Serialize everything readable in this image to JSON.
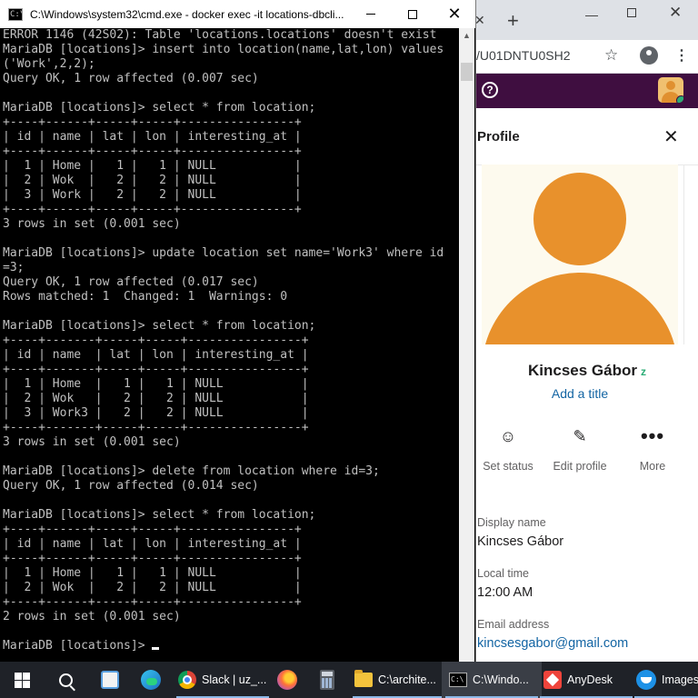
{
  "cmd_window": {
    "title": "C:\\Windows\\system32\\cmd.exe - docker  exec -it locations-dbcli...",
    "app_icon_glyph": "C:\\",
    "controls": {
      "minimize": "",
      "maximize": "",
      "close": "✕"
    },
    "console_lines": [
      "ERROR 1146 (42S02): Table 'locations.locations' doesn't exist",
      "MariaDB [locations]> insert into location(name,lat,lon) values",
      "('Work',2,2);",
      "Query OK, 1 row affected (0.007 sec)",
      "",
      "MariaDB [locations]> select * from location;",
      "+----+------+-----+-----+----------------+",
      "| id | name | lat | lon | interesting_at |",
      "+----+------+-----+-----+----------------+",
      "|  1 | Home |   1 |   1 | NULL           |",
      "|  2 | Wok  |   2 |   2 | NULL           |",
      "|  3 | Work |   2 |   2 | NULL           |",
      "+----+------+-----+-----+----------------+",
      "3 rows in set (0.001 sec)",
      "",
      "MariaDB [locations]> update location set name='Work3' where id",
      "=3;",
      "Query OK, 1 row affected (0.017 sec)",
      "Rows matched: 1  Changed: 1  Warnings: 0",
      "",
      "MariaDB [locations]> select * from location;",
      "+----+-------+-----+-----+----------------+",
      "| id | name  | lat | lon | interesting_at |",
      "+----+-------+-----+-----+----------------+",
      "|  1 | Home  |   1 |   1 | NULL           |",
      "|  2 | Wok   |   2 |   2 | NULL           |",
      "|  3 | Work3 |   2 |   2 | NULL           |",
      "+----+-------+-----+-----+----------------+",
      "3 rows in set (0.001 sec)",
      "",
      "MariaDB [locations]> delete from location where id=3;",
      "Query OK, 1 row affected (0.014 sec)",
      "",
      "MariaDB [locations]> select * from location;",
      "+----+------+-----+-----+----------------+",
      "| id | name | lat | lon | interesting_at |",
      "+----+------+-----+-----+----------------+",
      "|  1 | Home |   1 |   1 | NULL           |",
      "|  2 | Wok  |   2 |   2 | NULL           |",
      "+----+------+-----+-----+----------------+",
      "2 rows in set (0.001 sec)",
      ""
    ],
    "prompt": "MariaDB [locations]> ",
    "scroll_up_glyph": "▲"
  },
  "browser": {
    "tab_close": "✕",
    "new_tab": "+",
    "controls": {
      "minimize": "—",
      "close": "✕"
    },
    "url": "/U01DNTU0SH2",
    "star_icon": "☆",
    "menu_icon": "⋮"
  },
  "slack": {
    "help_glyph": "?",
    "profile": {
      "header": "Profile",
      "close_glyph": "✕",
      "name": "Kincses Gábor",
      "status_glyph": "z",
      "add_title": "Add a title",
      "actions": [
        {
          "icon": "☺",
          "label": "Set status"
        },
        {
          "icon": "✎",
          "label": "Edit profile"
        },
        {
          "icon": "•••",
          "label": "More"
        }
      ],
      "fields": {
        "display_name_label": "Display name",
        "display_name": "Kincses Gábor",
        "local_time_label": "Local time",
        "local_time": "12:00 AM",
        "email_label": "Email address",
        "email": "kincsesgabor@gmail.com"
      },
      "colors": {
        "avatar": "#e8912c",
        "avatar_bg": "#fdfaee",
        "link": "#1264a3",
        "workspace_bar": "#3f0e40",
        "presence": "#2bac76"
      }
    }
  },
  "taskbar": {
    "chrome_label": "Slack | uz_...",
    "explorer_label": "C:\\archite...",
    "cmd_label": "C:\\Windo...",
    "anydesk_label": "AnyDesk",
    "docker_label": "Images",
    "icons": [
      "windows-start-icon",
      "search-icon",
      "app-icon",
      "edge-icon",
      "chrome-icon",
      "firefox-icon",
      "calculator-icon",
      "folder-icon",
      "cmd-icon",
      "anydesk-icon",
      "docker-icon"
    ]
  }
}
